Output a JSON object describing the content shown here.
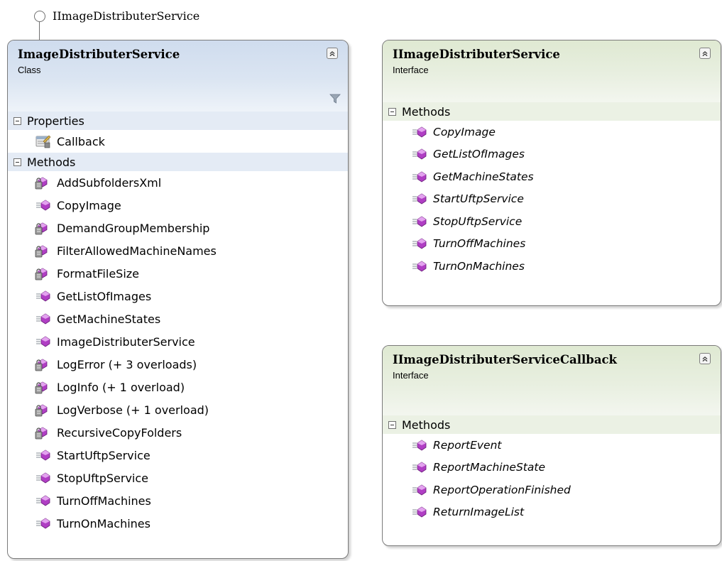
{
  "lollipop": {
    "label": "IImageDistributerService"
  },
  "class_shape": {
    "title": "ImageDistributerService",
    "kind": "Class",
    "properties_header": "Properties",
    "properties": [
      {
        "name": "Callback",
        "icon": "property-icon"
      }
    ],
    "methods_header": "Methods",
    "methods": [
      {
        "name": "AddSubfoldersXml",
        "icon": "private-method-icon"
      },
      {
        "name": "CopyImage",
        "icon": "public-method-icon"
      },
      {
        "name": "DemandGroupMembership",
        "icon": "private-method-icon"
      },
      {
        "name": "FilterAllowedMachineNames",
        "icon": "private-method-icon"
      },
      {
        "name": "FormatFileSize",
        "icon": "private-method-icon"
      },
      {
        "name": "GetListOfImages",
        "icon": "public-method-icon"
      },
      {
        "name": "GetMachineStates",
        "icon": "public-method-icon"
      },
      {
        "name": "ImageDistributerService",
        "icon": "public-method-icon"
      },
      {
        "name": "LogError (+ 3 overloads)",
        "icon": "private-method-icon"
      },
      {
        "name": "LogInfo (+ 1 overload)",
        "icon": "private-method-icon"
      },
      {
        "name": "LogVerbose (+ 1 overload)",
        "icon": "private-method-icon"
      },
      {
        "name": "RecursiveCopyFolders",
        "icon": "private-method-icon"
      },
      {
        "name": "StartUftpService",
        "icon": "public-method-icon"
      },
      {
        "name": "StopUftpService",
        "icon": "public-method-icon"
      },
      {
        "name": "TurnOffMachines",
        "icon": "public-method-icon"
      },
      {
        "name": "TurnOnMachines",
        "icon": "public-method-icon"
      }
    ]
  },
  "interface_shape": {
    "title": "IImageDistributerService",
    "kind": "Interface",
    "methods_header": "Methods",
    "methods": [
      {
        "name": "CopyImage",
        "icon": "public-method-icon"
      },
      {
        "name": "GetListOfImages",
        "icon": "public-method-icon"
      },
      {
        "name": "GetMachineStates",
        "icon": "public-method-icon"
      },
      {
        "name": "StartUftpService",
        "icon": "public-method-icon"
      },
      {
        "name": "StopUftpService",
        "icon": "public-method-icon"
      },
      {
        "name": "TurnOffMachines",
        "icon": "public-method-icon"
      },
      {
        "name": "TurnOnMachines",
        "icon": "public-method-icon"
      }
    ]
  },
  "callback_shape": {
    "title": "IImageDistributerServiceCallback",
    "kind": "Interface",
    "methods_header": "Methods",
    "methods": [
      {
        "name": "ReportEvent",
        "icon": "public-method-icon"
      },
      {
        "name": "ReportMachineState",
        "icon": "public-method-icon"
      },
      {
        "name": "ReportOperationFinished",
        "icon": "public-method-icon"
      },
      {
        "name": "ReturnImageList",
        "icon": "public-method-icon"
      }
    ]
  }
}
